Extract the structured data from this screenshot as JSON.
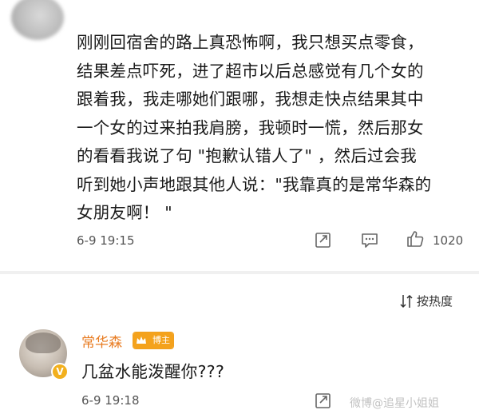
{
  "comment": {
    "body": "刚刚回宿舍的路上真恐怖啊，我只想买点零食，\n结果差点吓死，进了超市以后总感觉有几个女的\n跟着我，我走哪她们跟哪，我想走快点结果其中\n一个女的过来拍我肩膀，我顿时一慌，然后那女\n的看看我说了句 \"抱歉认错人了\" ，然后过会我\n听到她小声地跟其他人说：\"我靠真的是常华森的\n女朋友啊！ \"",
    "time": "6-9 19:15",
    "like_count": "1020",
    "icons": [
      "share-icon",
      "comment-icon",
      "like-icon"
    ]
  },
  "sort": {
    "label": "按热度",
    "icon": "sort-icon"
  },
  "reply": {
    "username": "常华森",
    "badge": "博主",
    "verified_mark": "V",
    "text": "几盆水能泼醒你???",
    "time": "6-9 19:18",
    "icons": [
      "share-icon",
      "comment-icon",
      "like-icon"
    ]
  },
  "watermark": "微博@追星小姐姐",
  "colors": {
    "username": "#e87c22",
    "badge": "#f4a21c",
    "divider": "#f0f0f0"
  }
}
